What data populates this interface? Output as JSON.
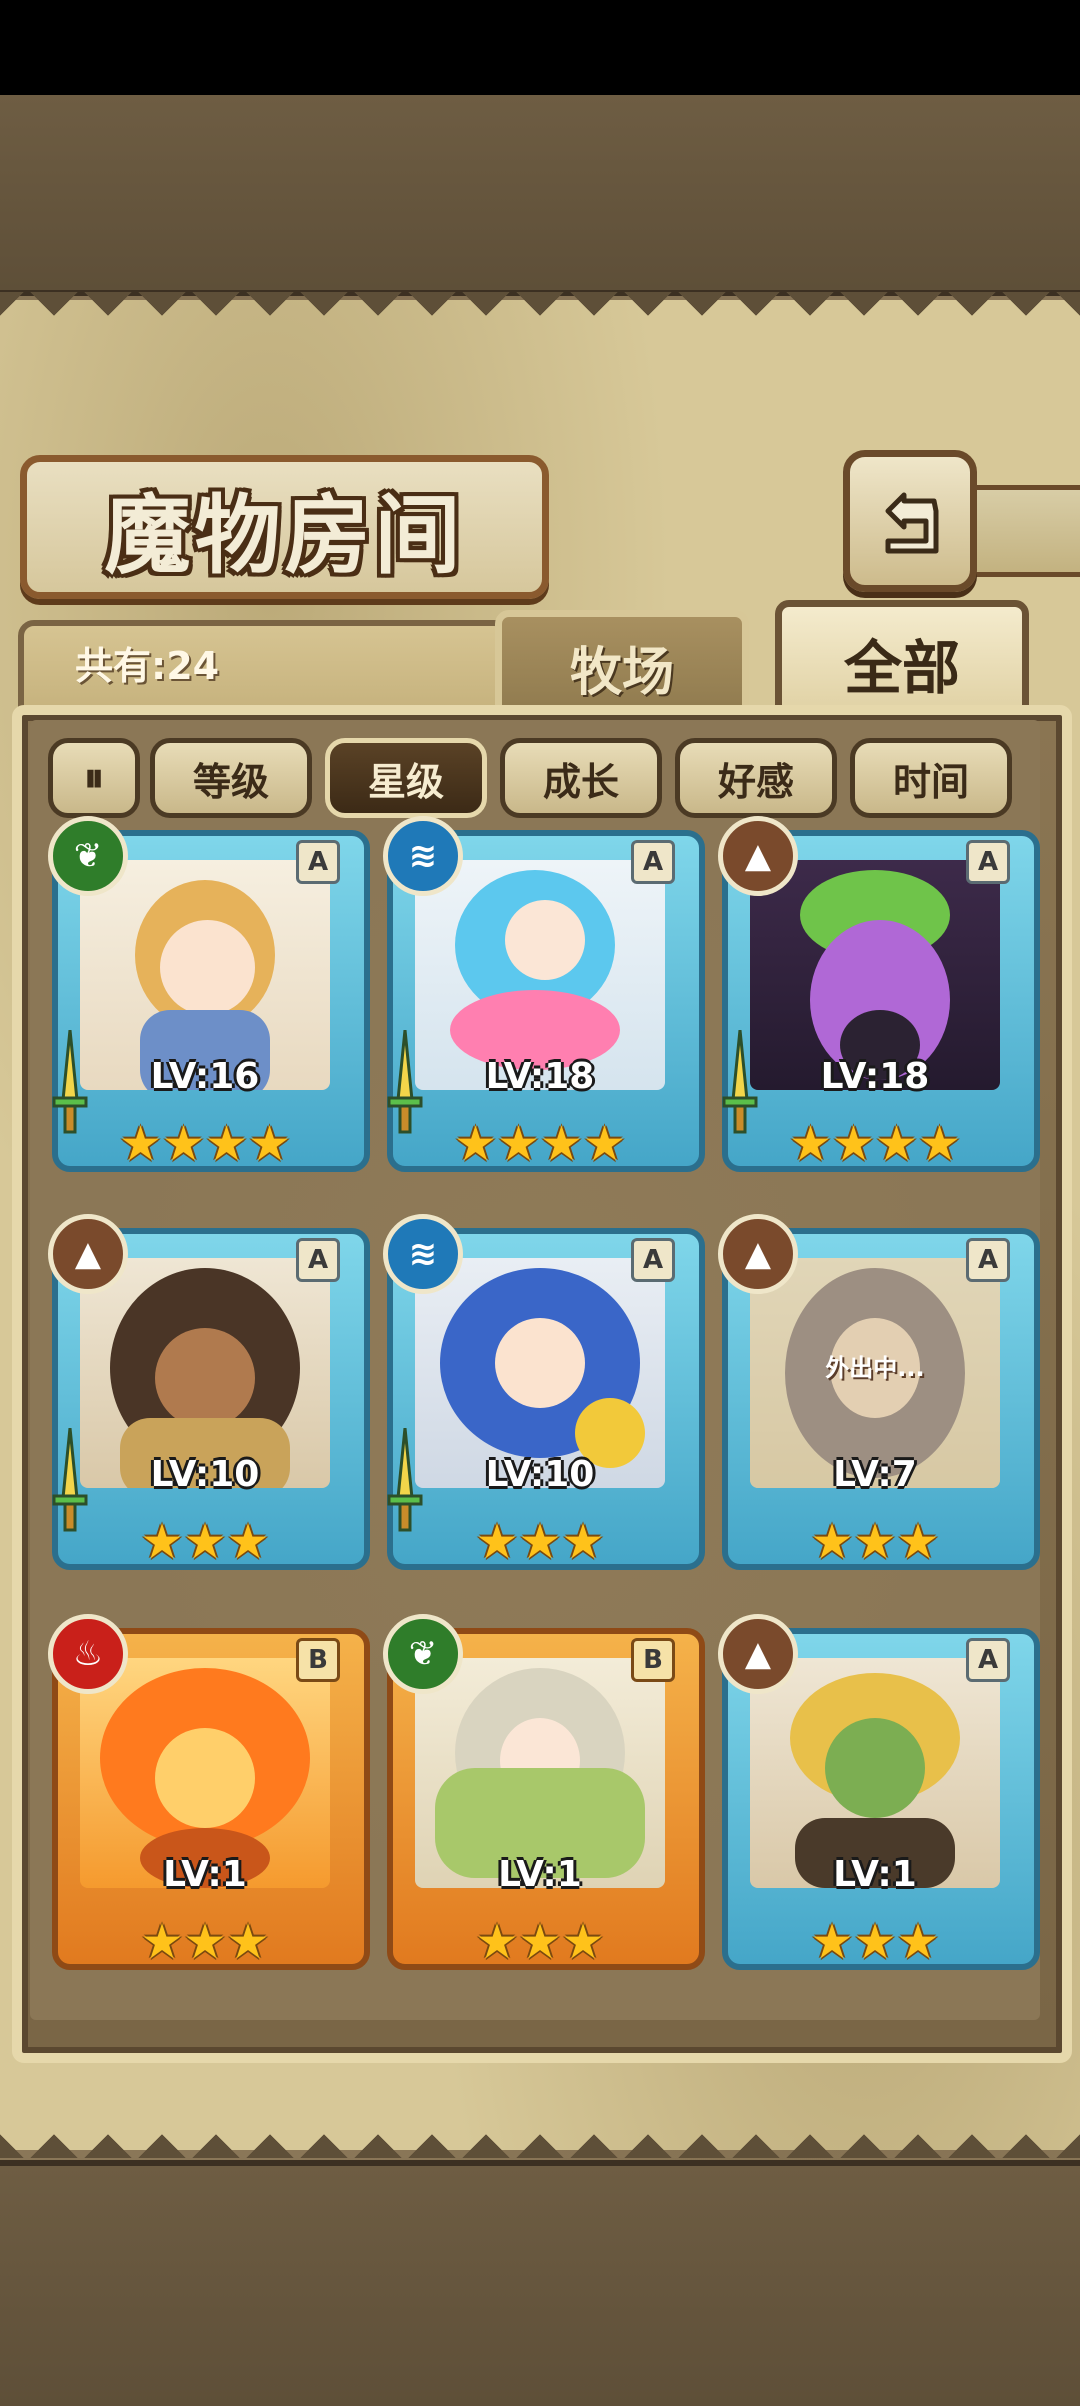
{
  "header": {
    "title": "魔物房间",
    "back_icon": "back-arrow-icon"
  },
  "tabs": {
    "count_label": "共有:24",
    "farm": "牧场",
    "all": "全部",
    "active": "全部"
  },
  "sort": {
    "toggle_icon": "sort-order-icon",
    "buttons": [
      "等级",
      "星级",
      "成长",
      "好感",
      "时间"
    ],
    "active": "星级"
  },
  "monsters": [
    {
      "level": "LV:16",
      "stars": 4,
      "grade": "A",
      "element": "wood",
      "has_weapon": true,
      "status": ""
    },
    {
      "level": "LV:18",
      "stars": 4,
      "grade": "A",
      "element": "water",
      "has_weapon": true,
      "status": ""
    },
    {
      "level": "LV:18",
      "stars": 4,
      "grade": "A",
      "element": "earth",
      "has_weapon": true,
      "status": ""
    },
    {
      "level": "LV:10",
      "stars": 3,
      "grade": "A",
      "element": "earth",
      "has_weapon": true,
      "status": ""
    },
    {
      "level": "LV:10",
      "stars": 3,
      "grade": "A",
      "element": "water",
      "has_weapon": true,
      "status": ""
    },
    {
      "level": "LV:7",
      "stars": 3,
      "grade": "A",
      "element": "earth",
      "has_weapon": false,
      "status": "外出中..."
    },
    {
      "level": "LV:1",
      "stars": 3,
      "grade": "B",
      "element": "fire",
      "has_weapon": false,
      "status": ""
    },
    {
      "level": "LV:1",
      "stars": 3,
      "grade": "B",
      "element": "wood",
      "has_weapon": false,
      "status": ""
    },
    {
      "level": "LV:1",
      "stars": 3,
      "grade": "A",
      "element": "earth",
      "has_weapon": false,
      "status": ""
    }
  ],
  "colors": {
    "grade_a_frame": "#45a6c8",
    "grade_b_frame": "#e17a1f",
    "star": "#ffc21a",
    "parchment": "#d7c898"
  }
}
